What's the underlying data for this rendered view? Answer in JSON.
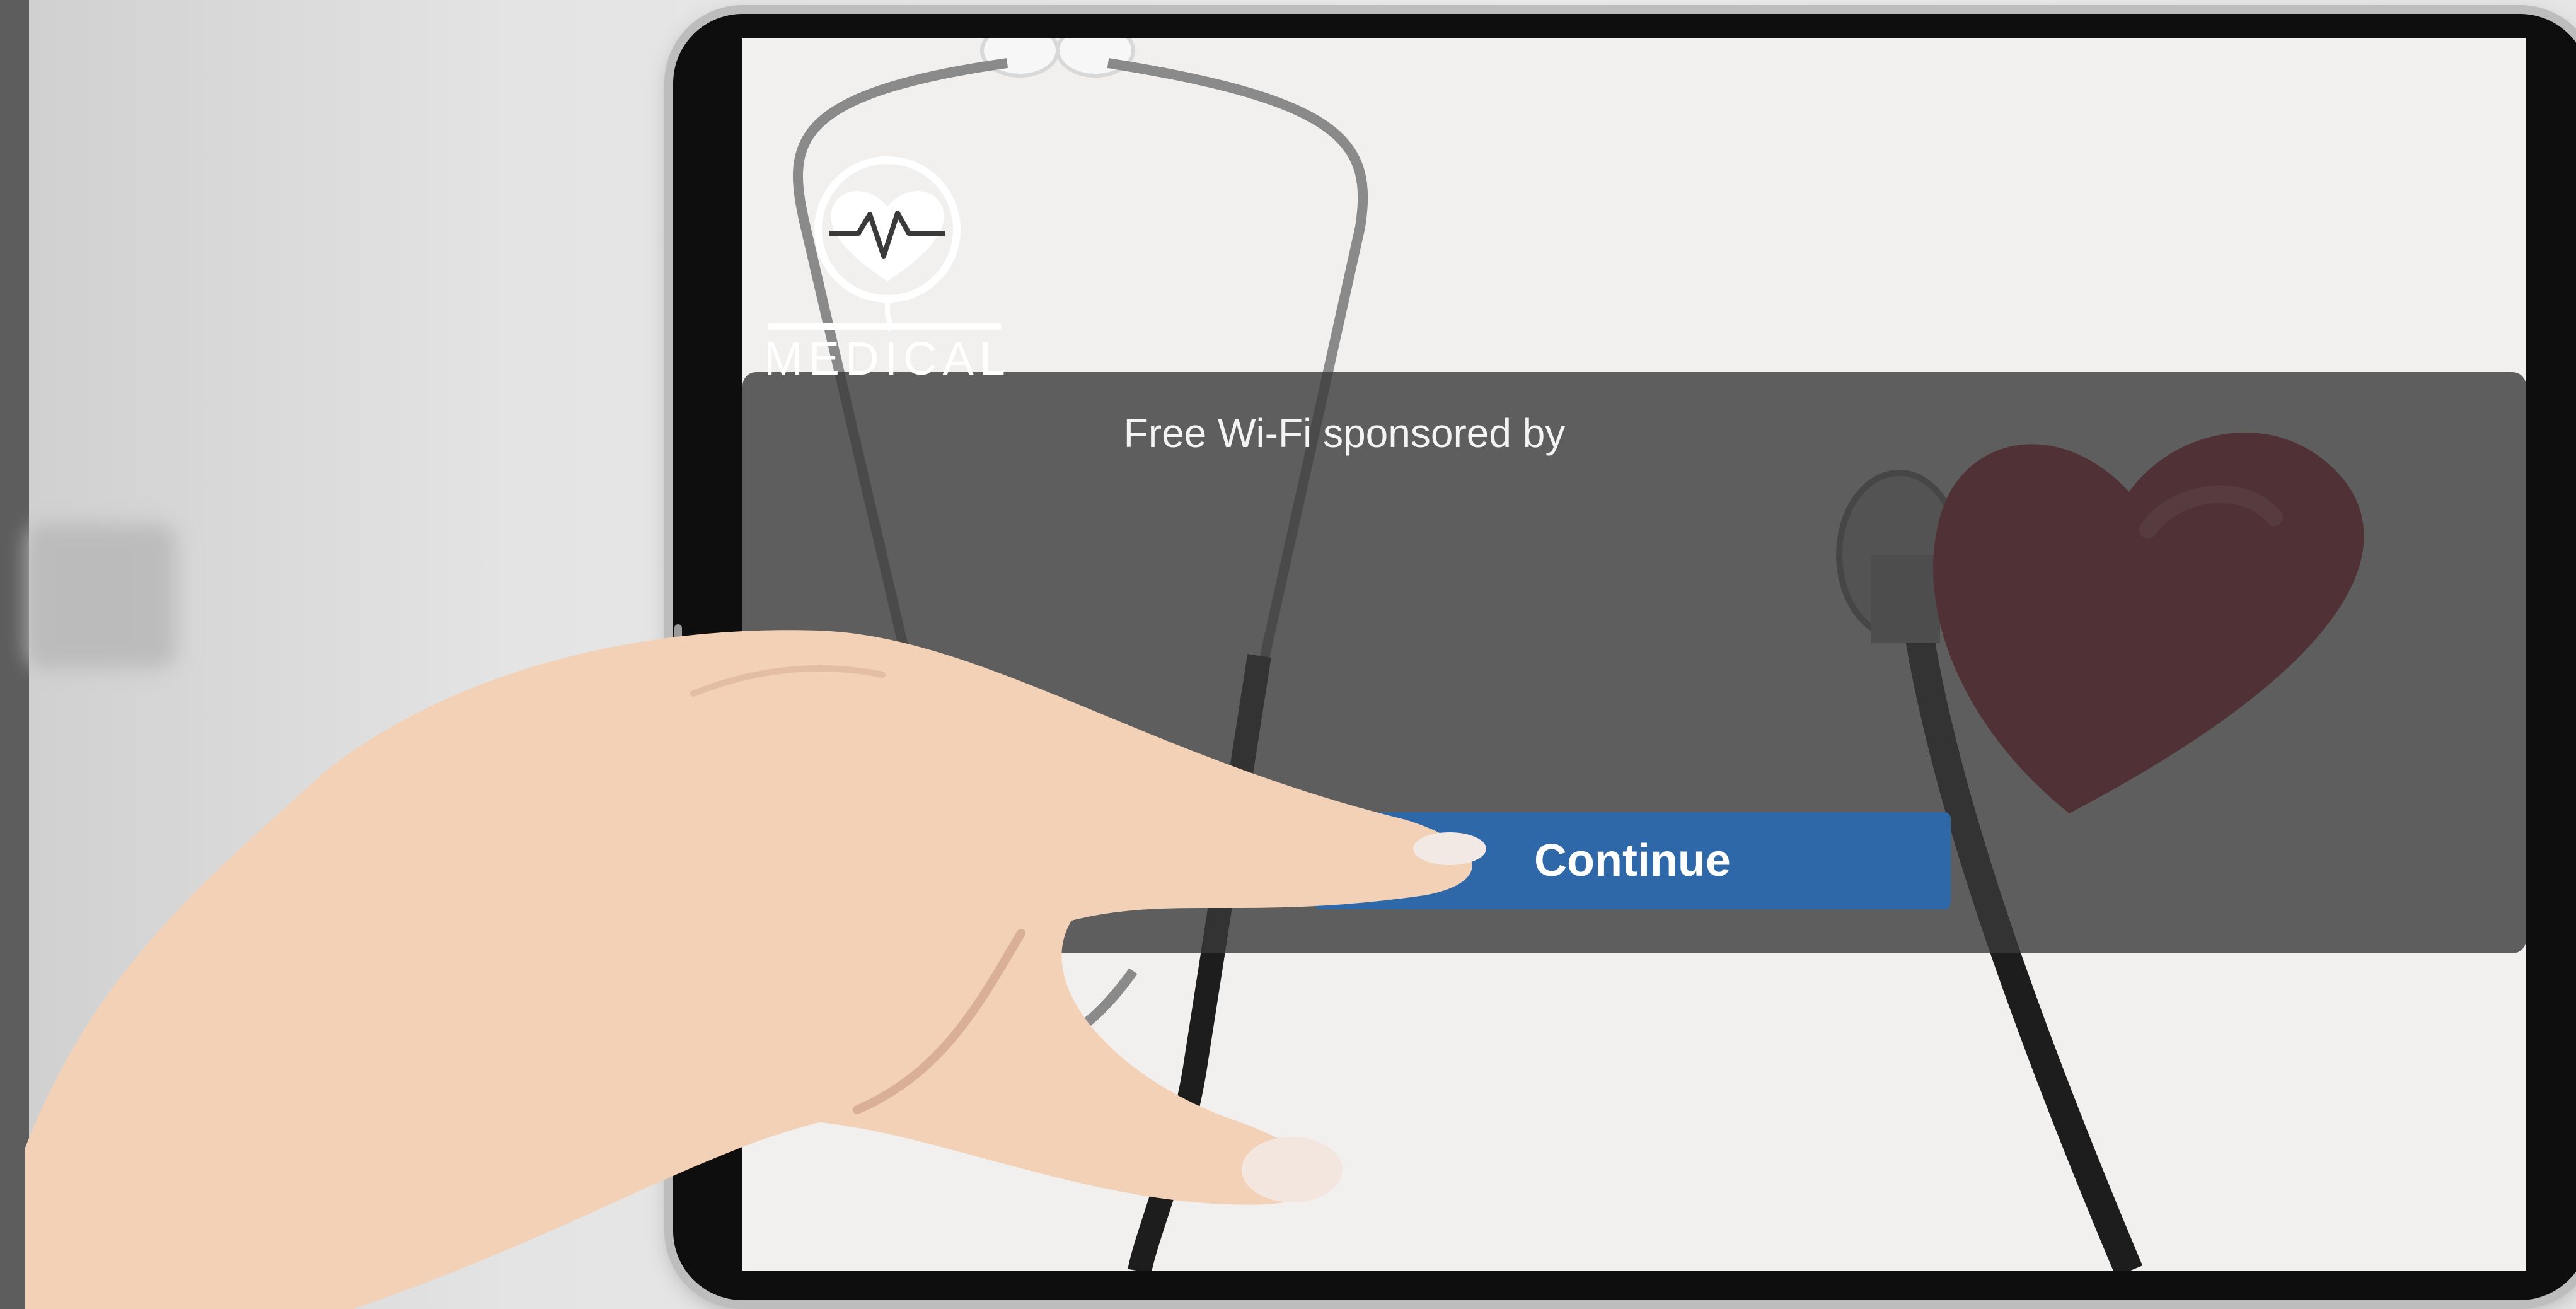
{
  "captive_portal": {
    "sponsor_text": "Free Wi-Fi sponsored by",
    "logo_text": "MEDICAL",
    "logo_icon": "heart-pulse-icon",
    "continue_label": "Continue"
  },
  "colors": {
    "button": "#2f68a8",
    "overlay": "#3a3a3a",
    "heart": "#b0162b"
  }
}
